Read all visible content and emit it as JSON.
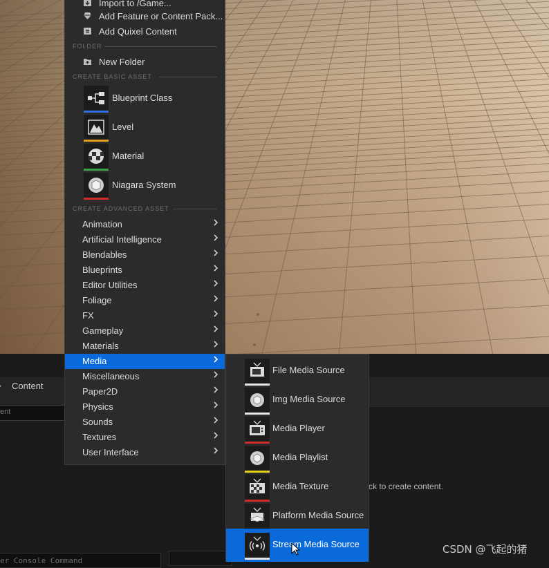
{
  "menu": {
    "top_items": [
      {
        "label": "Import to /Game...",
        "icon": "import-icon"
      },
      {
        "label": "Add Feature or Content Pack...",
        "icon": "feature-pack-icon"
      },
      {
        "label": "Add Quixel Content",
        "icon": "quixel-icon"
      }
    ],
    "folder_section": "FOLDER",
    "new_folder": {
      "label": "New Folder",
      "icon": "new-folder-icon"
    },
    "basic_section": "CREATE BASIC ASSET",
    "basic_assets": [
      {
        "label": "Blueprint Class",
        "icon": "blueprint-class-icon",
        "color": "#2f6fe0"
      },
      {
        "label": "Level",
        "icon": "level-icon",
        "color": "#e8a020"
      },
      {
        "label": "Material",
        "icon": "material-icon",
        "color": "#3aa34a"
      },
      {
        "label": "Niagara System",
        "icon": "niagara-icon",
        "color": "#d42a2a"
      }
    ],
    "advanced_section": "CREATE ADVANCED ASSET",
    "advanced_items": [
      "Animation",
      "Artificial Intelligence",
      "Blendables",
      "Blueprints",
      "Editor Utilities",
      "Foliage",
      "FX",
      "Gameplay",
      "Materials",
      "Media",
      "Miscellaneous",
      "Paper2D",
      "Physics",
      "Sounds",
      "Textures",
      "User Interface"
    ],
    "active_item": "Media",
    "highlight_color": "#0b6ad9"
  },
  "media_submenu": {
    "items": [
      {
        "label": "File Media Source",
        "icon": "file-media-source-icon",
        "color": "#e8e8e8"
      },
      {
        "label": "Img Media Source",
        "icon": "img-media-source-icon",
        "color": "#e8e8e8"
      },
      {
        "label": "Media Player",
        "icon": "media-player-icon",
        "color": "#d42a2a"
      },
      {
        "label": "Media Playlist",
        "icon": "media-playlist-icon",
        "color": "#e6d21c"
      },
      {
        "label": "Media Texture",
        "icon": "media-texture-icon",
        "color": "#d42a2a"
      },
      {
        "label": "Platform Media Source",
        "icon": "platform-media-source-icon",
        "color": "#e8e8e8"
      },
      {
        "label": "Stream Media Source",
        "icon": "stream-media-source-icon",
        "color": "#e8e8e8"
      }
    ],
    "active_item": "Stream Media Source"
  },
  "content_browser": {
    "tab_label": "Content",
    "search_placeholder": "ent",
    "hint_text": "ck to create content."
  },
  "console": {
    "placeholder": "er Console Command"
  },
  "watermark": "CSDN @飞起的猪"
}
